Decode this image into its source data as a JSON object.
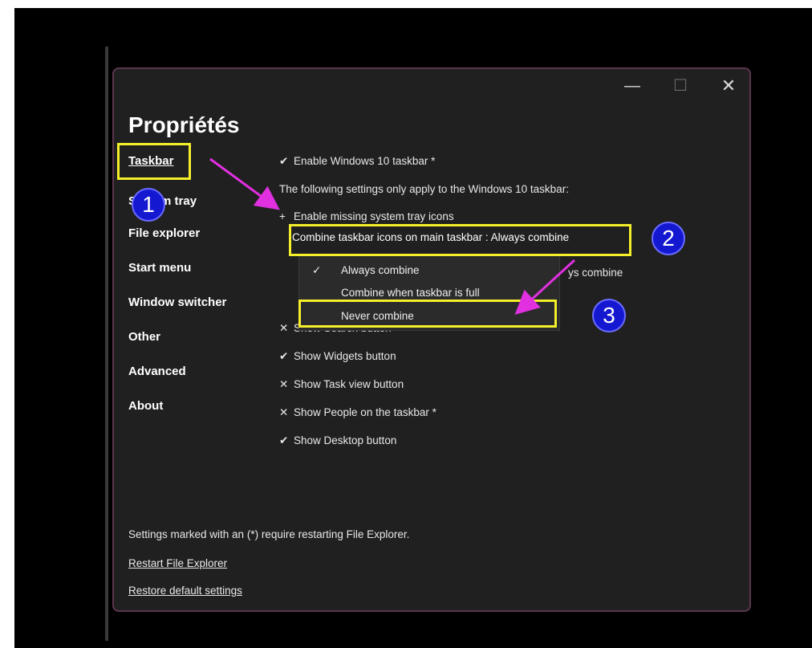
{
  "window": {
    "title": "Propriétés",
    "controls": {
      "minimize": "—",
      "maximize": "☐",
      "close": "✕"
    }
  },
  "nav": [
    {
      "label": "Taskbar"
    },
    {
      "label": "System tray"
    },
    {
      "label": "File explorer"
    },
    {
      "label": "Start menu"
    },
    {
      "label": "Window switcher"
    },
    {
      "label": "Other"
    },
    {
      "label": "Advanced"
    },
    {
      "label": "About"
    }
  ],
  "settings": {
    "enable_win10": {
      "mark": "✔",
      "label": "Enable Windows 10 taskbar *"
    },
    "note": "The following settings only apply to the Windows 10 taskbar:",
    "missing_tray": {
      "mark": "+",
      "label": "Enable missing system tray icons"
    },
    "combine_label": "Combine taskbar icons on main taskbar : Always combine",
    "combine_partial": "ys combine",
    "search": {
      "mark": "✕",
      "label": "Show Search button"
    },
    "widgets": {
      "mark": "✔",
      "label": "Show Widgets button"
    },
    "taskview": {
      "mark": "✕",
      "label": "Show Task view button"
    },
    "people": {
      "mark": "✕",
      "label": "Show People on the taskbar *"
    },
    "desktop": {
      "mark": "✔",
      "label": "Show Desktop button"
    }
  },
  "dropdown": {
    "items": [
      {
        "check": "✓",
        "label": "Always combine"
      },
      {
        "check": "",
        "label": "Combine when taskbar is full"
      },
      {
        "check": "",
        "label": "Never combine"
      }
    ]
  },
  "footer": {
    "note": "Settings marked with an (*) require restarting File Explorer.",
    "restart": "Restart File Explorer",
    "restore": "Restore default settings"
  },
  "annotations": {
    "badges": [
      "1",
      "2",
      "3"
    ],
    "highlight_color": "#f4ee2b",
    "arrow_color": "#e030e0",
    "badge_color": "#1418d0"
  }
}
